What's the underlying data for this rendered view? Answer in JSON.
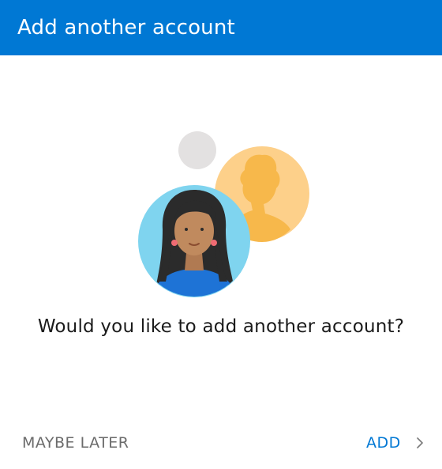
{
  "header": {
    "title": "Add another account",
    "color": "#0078d4"
  },
  "main": {
    "question": "Would you like to add another account?",
    "illustration": "two-accounts-illustration"
  },
  "footer": {
    "later_label": "MAYBE LATER",
    "add_label": "ADD",
    "add_icon": "chevron-right-icon"
  }
}
